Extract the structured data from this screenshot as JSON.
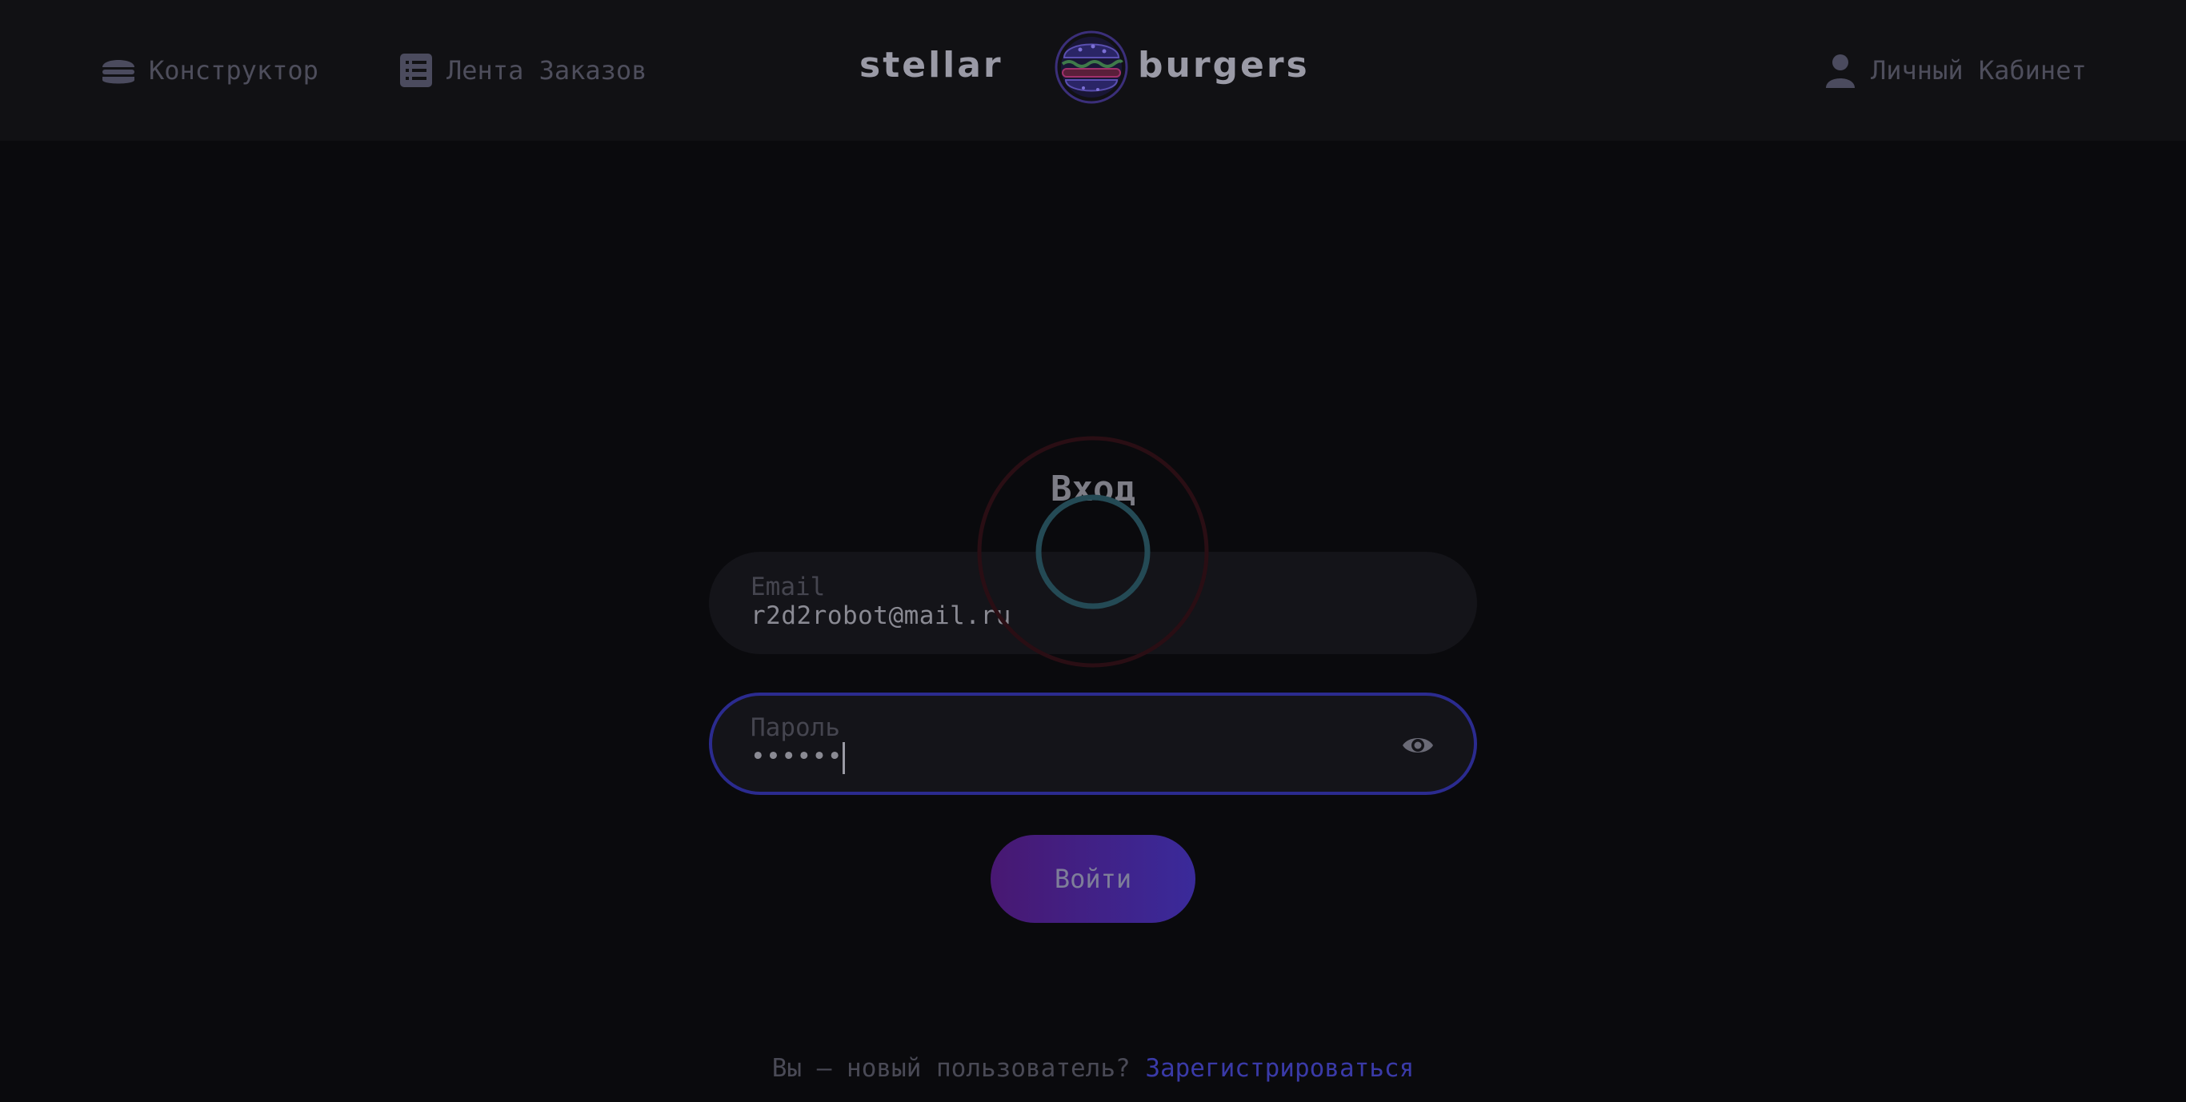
{
  "header": {
    "nav_constructor": "Конструктор",
    "nav_feed": "Лента Заказов",
    "nav_profile": "Личный Кабинет",
    "logo_left": "stellar",
    "logo_right": "burgers"
  },
  "form": {
    "title": "Вход",
    "email": {
      "label": "Email",
      "value": "r2d2robot@mail.ru"
    },
    "password": {
      "label": "Пароль",
      "value": "••••••",
      "toggle_icon": "eye-icon"
    },
    "submit_label": "Войти"
  },
  "footer": {
    "question": "Вы — новый пользователь? ",
    "register_link": "Зарегистрироваться"
  },
  "icons": {
    "constructor": "burger-icon",
    "feed": "list-icon",
    "profile": "user-icon",
    "loader": "spinner"
  },
  "colors": {
    "background": "#0a0a0d",
    "header": "#111114",
    "accent": "#2b2b8f",
    "button_gradient_start": "#481872",
    "button_gradient_end": "#3a2a9a"
  }
}
